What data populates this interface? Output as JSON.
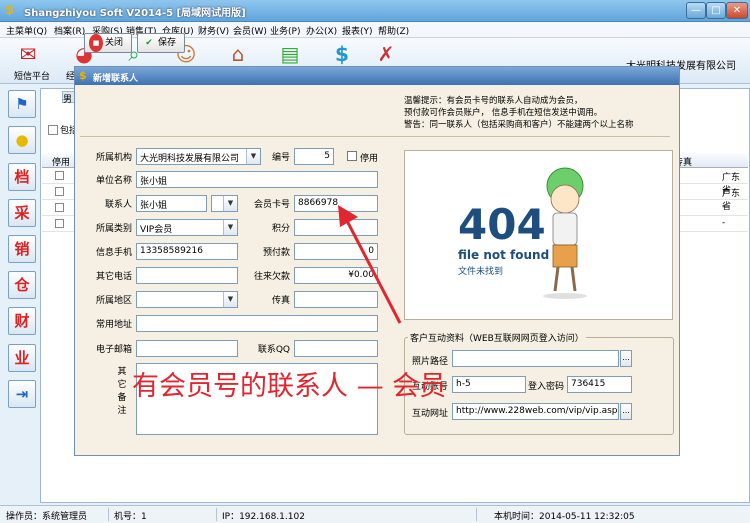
{
  "window": {
    "title": "Shangzhiyou Soft V2014-5 [局域网试用版]",
    "minimize_glyph": "—",
    "maximize_glyph": "□",
    "close_glyph": "✕"
  },
  "menu": [
    "主菜单(Q)",
    "档案(R)",
    "采购(S)",
    "销售(T)",
    "仓库(U)",
    "财务(V)",
    "会员(W)",
    "业务(P)",
    "办公(X)",
    "报表(Y)",
    "帮助(Z)"
  ],
  "toolbar": {
    "items": [
      {
        "icon": "mail-icon",
        "label": "短信平台"
      },
      {
        "icon": "pie-chart-icon",
        "label": "经"
      },
      {
        "icon": "magnifier-icon",
        "label": ""
      },
      {
        "icon": "person-icon",
        "label": ""
      },
      {
        "icon": "home-icon",
        "label": ""
      },
      {
        "icon": "money-icon",
        "label": ""
      },
      {
        "icon": "dollar-icon",
        "label": ""
      },
      {
        "icon": "tools-icon",
        "label": ""
      }
    ],
    "company": "大光明科技发展有限公司"
  },
  "sidebar": [
    "flag-icon",
    "bulb-icon",
    "档",
    "采",
    "销",
    "仓",
    "财",
    "业",
    "exit-icon"
  ],
  "background": {
    "tab_label": "男",
    "checkbox_label": "包括",
    "columns": [
      "停用",
      "传真"
    ],
    "rows": [
      {
        "cell": "广东省"
      },
      {
        "cell": "广东省"
      },
      {
        "cell": "-"
      },
      {
        "cell": "-"
      }
    ]
  },
  "status": {
    "operator": "操作员：系统管理员",
    "machine": "机号：1",
    "ip": "IP：192.168.1.102",
    "time": "本机时间：2014-05-11 12:32:05"
  },
  "dialog": {
    "title": "新增联系人",
    "close_label": "关闭",
    "save_label": "保存",
    "tips": {
      "line1": "温馨提示：有会员卡号的联系人自动成为会员，",
      "line2": "预付款可作会员账户，  信息手机在短信发送中调用。",
      "line3": "警告：同一联系人（包括采购商和客户）不能建两个以上名称"
    },
    "fields": {
      "org_label": "所属机构",
      "org_value": "大光明科技发展有限公司",
      "code_label": "编号",
      "code_value": "5",
      "disabled_label": "停用",
      "unit_label": "单位名称",
      "unit_value": "张小姐",
      "contact_label": "联系人",
      "contact_value": "张小姐",
      "card_label": "会员卡号",
      "card_value": "8866978",
      "category_label": "所属类别",
      "category_value": "VIP会员",
      "points_label": "积分",
      "points_value": "",
      "mobile_label": "信息手机",
      "mobile_value": "13358589216",
      "prepay_label": "预付款",
      "prepay_value": "0",
      "phone_label": "其它电话",
      "phone_value": "",
      "arrears_label": "往来欠款",
      "arrears_value": "¥0.00",
      "region_label": "所属地区",
      "region_value": "",
      "fax_label": "传真",
      "fax_value": "",
      "address_label": "常用地址",
      "address_value": "",
      "email_label": "电子邮箱",
      "email_value": "",
      "qq_label": "联系QQ",
      "qq_value": "",
      "notes_label": "其它备注"
    },
    "image_404": {
      "big": "404",
      "line1": "file not found",
      "line2": "文件未找到"
    },
    "web_group": {
      "title": "客户互动资料（WEB互联网网页登入访问）",
      "photo_label": "照片路径",
      "photo_value": "",
      "account_label": "互动账号",
      "account_value": "h-5",
      "password_label": "登入密码",
      "password_value": "736415",
      "url_label": "互动网址",
      "url_value": "http://www.228web.com/vip/vip.aspx?dm",
      "ellipsis": "..."
    }
  },
  "annotation": {
    "text": "有会员号的联系人 — 会员",
    "color": "#e2262f"
  }
}
